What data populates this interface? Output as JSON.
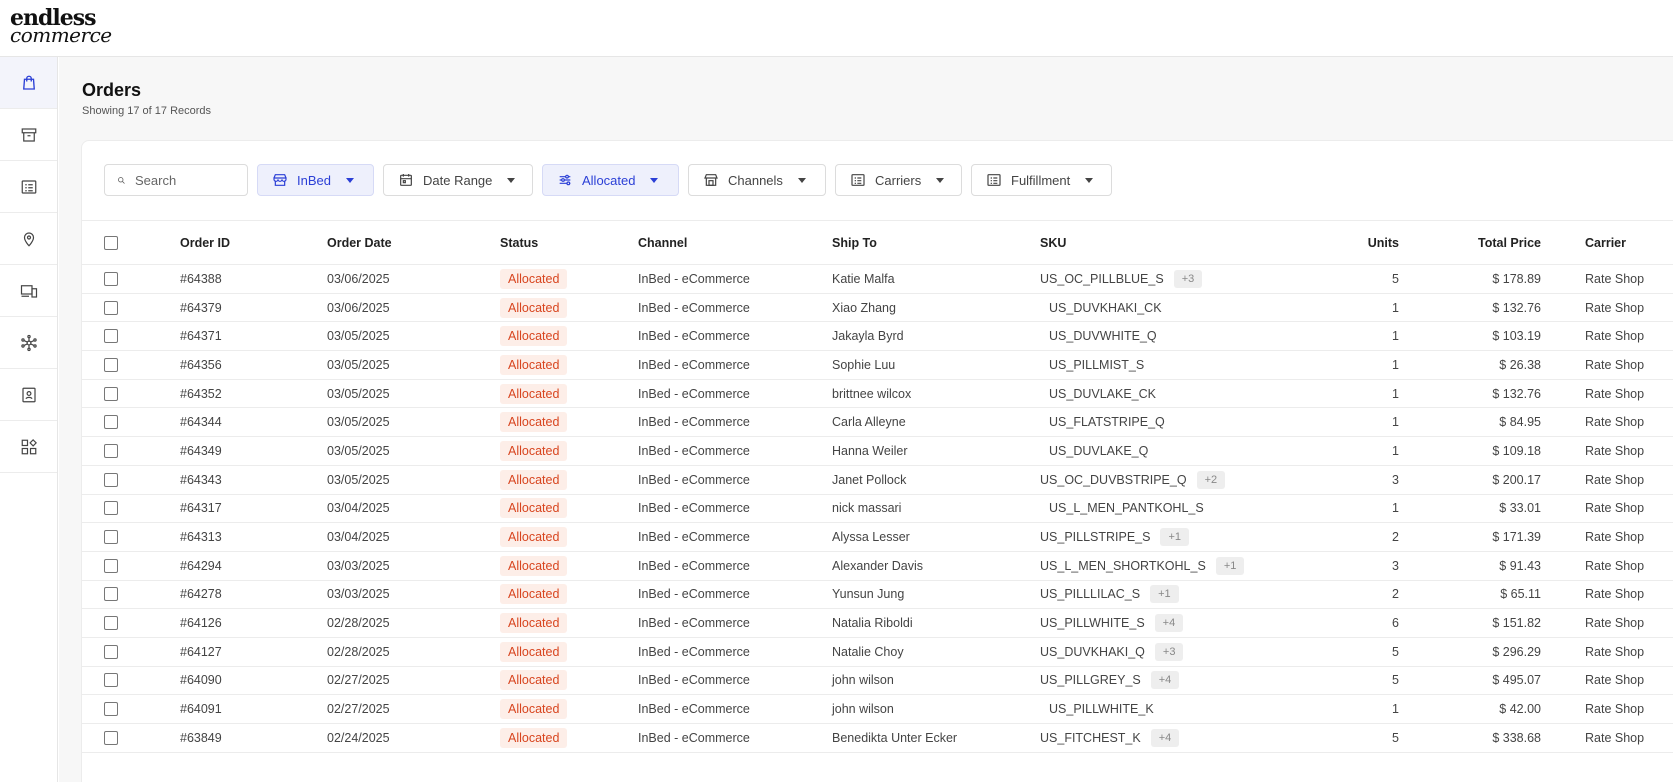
{
  "brand": {
    "line1": "endless",
    "line2": "commerce"
  },
  "sidebar": {
    "items": [
      {
        "name": "orders",
        "icon": "shopping-bag-icon",
        "active": true
      },
      {
        "name": "inventory",
        "icon": "archive-box-icon",
        "active": false
      },
      {
        "name": "products",
        "icon": "list-icon",
        "active": false
      },
      {
        "name": "locations",
        "icon": "map-pin-icon",
        "active": false
      },
      {
        "name": "channels",
        "icon": "devices-icon",
        "active": false
      },
      {
        "name": "integrations",
        "icon": "network-icon",
        "active": false
      },
      {
        "name": "customers",
        "icon": "id-card-icon",
        "active": false
      },
      {
        "name": "apps",
        "icon": "apps-grid-icon",
        "active": false
      }
    ]
  },
  "page": {
    "title": "Orders",
    "subtitle": "Showing 17 of 17 Records"
  },
  "filters": {
    "search_placeholder": "Search",
    "store": "InBed",
    "date_range": "Date Range",
    "status": "Allocated",
    "channels": "Channels",
    "carriers": "Carriers",
    "fulfillment": "Fulfillment"
  },
  "table": {
    "columns": {
      "order_id": "Order ID",
      "order_date": "Order Date",
      "status": "Status",
      "channel": "Channel",
      "ship_to": "Ship To",
      "sku": "SKU",
      "units": "Units",
      "total_price": "Total Price",
      "carrier": "Carrier"
    },
    "rows": [
      {
        "order_id": "#64388",
        "order_date": "03/06/2025",
        "status": "Allocated",
        "channel": "InBed - eCommerce",
        "ship_to": "Katie Malfa",
        "sku": "US_OC_PILLBLUE_S",
        "sku_more": "+3",
        "units": "5",
        "total_price": "$ 178.89",
        "carrier": "Rate Shop"
      },
      {
        "order_id": "#64379",
        "order_date": "03/06/2025",
        "status": "Allocated",
        "channel": "InBed - eCommerce",
        "ship_to": "Xiao Zhang",
        "sku": "US_DUVKHAKI_CK",
        "sku_more": "",
        "units": "1",
        "total_price": "$ 132.76",
        "carrier": "Rate Shop"
      },
      {
        "order_id": "#64371",
        "order_date": "03/05/2025",
        "status": "Allocated",
        "channel": "InBed - eCommerce",
        "ship_to": "Jakayla Byrd",
        "sku": "US_DUVWHITE_Q",
        "sku_more": "",
        "units": "1",
        "total_price": "$ 103.19",
        "carrier": "Rate Shop"
      },
      {
        "order_id": "#64356",
        "order_date": "03/05/2025",
        "status": "Allocated",
        "channel": "InBed - eCommerce",
        "ship_to": "Sophie Luu",
        "sku": "US_PILLMIST_S",
        "sku_more": "",
        "units": "1",
        "total_price": "$ 26.38",
        "carrier": "Rate Shop"
      },
      {
        "order_id": "#64352",
        "order_date": "03/05/2025",
        "status": "Allocated",
        "channel": "InBed - eCommerce",
        "ship_to": "brittnee wilcox",
        "sku": "US_DUVLAKE_CK",
        "sku_more": "",
        "units": "1",
        "total_price": "$ 132.76",
        "carrier": "Rate Shop"
      },
      {
        "order_id": "#64344",
        "order_date": "03/05/2025",
        "status": "Allocated",
        "channel": "InBed - eCommerce",
        "ship_to": "Carla Alleyne",
        "sku": "US_FLATSTRIPE_Q",
        "sku_more": "",
        "units": "1",
        "total_price": "$ 84.95",
        "carrier": "Rate Shop"
      },
      {
        "order_id": "#64349",
        "order_date": "03/05/2025",
        "status": "Allocated",
        "channel": "InBed - eCommerce",
        "ship_to": "Hanna Weiler",
        "sku": "US_DUVLAKE_Q",
        "sku_more": "",
        "units": "1",
        "total_price": "$ 109.18",
        "carrier": "Rate Shop"
      },
      {
        "order_id": "#64343",
        "order_date": "03/05/2025",
        "status": "Allocated",
        "channel": "InBed - eCommerce",
        "ship_to": "Janet Pollock",
        "sku": "US_OC_DUVBSTRIPE_Q",
        "sku_more": "+2",
        "units": "3",
        "total_price": "$ 200.17",
        "carrier": "Rate Shop"
      },
      {
        "order_id": "#64317",
        "order_date": "03/04/2025",
        "status": "Allocated",
        "channel": "InBed - eCommerce",
        "ship_to": "nick massari",
        "sku": "US_L_MEN_PANTKOHL_S",
        "sku_more": "",
        "units": "1",
        "total_price": "$ 33.01",
        "carrier": "Rate Shop"
      },
      {
        "order_id": "#64313",
        "order_date": "03/04/2025",
        "status": "Allocated",
        "channel": "InBed - eCommerce",
        "ship_to": "Alyssa Lesser",
        "sku": "US_PILLSTRIPE_S",
        "sku_more": "+1",
        "units": "2",
        "total_price": "$ 171.39",
        "carrier": "Rate Shop"
      },
      {
        "order_id": "#64294",
        "order_date": "03/03/2025",
        "status": "Allocated",
        "channel": "InBed - eCommerce",
        "ship_to": "Alexander Davis",
        "sku": "US_L_MEN_SHORTKOHL_S",
        "sku_more": "+1",
        "units": "3",
        "total_price": "$ 91.43",
        "carrier": "Rate Shop"
      },
      {
        "order_id": "#64278",
        "order_date": "03/03/2025",
        "status": "Allocated",
        "channel": "InBed - eCommerce",
        "ship_to": "Yunsun Jung",
        "sku": "US_PILLLILAC_S",
        "sku_more": "+1",
        "units": "2",
        "total_price": "$ 65.11",
        "carrier": "Rate Shop"
      },
      {
        "order_id": "#64126",
        "order_date": "02/28/2025",
        "status": "Allocated",
        "channel": "InBed - eCommerce",
        "ship_to": "Natalia Riboldi",
        "sku": "US_PILLWHITE_S",
        "sku_more": "+4",
        "units": "6",
        "total_price": "$ 151.82",
        "carrier": "Rate Shop"
      },
      {
        "order_id": "#64127",
        "order_date": "02/28/2025",
        "status": "Allocated",
        "channel": "InBed - eCommerce",
        "ship_to": "Natalie Choy",
        "sku": "US_DUVKHAKI_Q",
        "sku_more": "+3",
        "units": "5",
        "total_price": "$ 296.29",
        "carrier": "Rate Shop"
      },
      {
        "order_id": "#64090",
        "order_date": "02/27/2025",
        "status": "Allocated",
        "channel": "InBed - eCommerce",
        "ship_to": "john wilson",
        "sku": "US_PILLGREY_S",
        "sku_more": "+4",
        "units": "5",
        "total_price": "$ 495.07",
        "carrier": "Rate Shop"
      },
      {
        "order_id": "#64091",
        "order_date": "02/27/2025",
        "status": "Allocated",
        "channel": "InBed - eCommerce",
        "ship_to": "john wilson",
        "sku": "US_PILLWHITE_K",
        "sku_more": "",
        "units": "1",
        "total_price": "$ 42.00",
        "carrier": "Rate Shop"
      },
      {
        "order_id": "#63849",
        "order_date": "02/24/2025",
        "status": "Allocated",
        "channel": "InBed - eCommerce",
        "ship_to": "Benedikta Unter Ecker",
        "sku": "US_FITCHEST_K",
        "sku_more": "+4",
        "units": "5",
        "total_price": "$ 338.68",
        "carrier": "Rate Shop"
      }
    ]
  },
  "colors": {
    "accent": "#2b3fd6",
    "status_text": "#d8451f",
    "status_bg": "#fdeee8"
  }
}
